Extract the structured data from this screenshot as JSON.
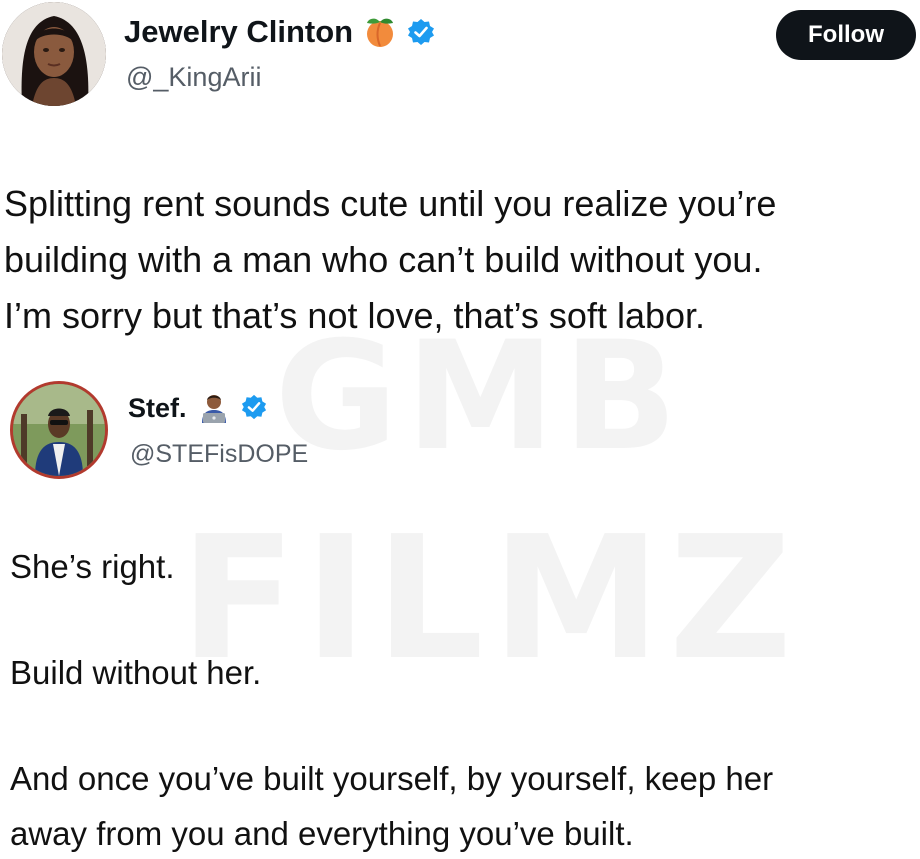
{
  "post": {
    "author": {
      "display_name": "Jewelry Clinton",
      "handle": "@_KingArii",
      "name_emoji": "peach-icon",
      "verified": true
    },
    "follow_label": "Follow",
    "text_lines": [
      "Splitting rent sounds cute until you realize you’re",
      "building with a man who can’t build without you.",
      "I’m sorry but that’s not love, that’s soft labor."
    ]
  },
  "reply": {
    "author": {
      "display_name": "Stef.",
      "handle": "@STEFisDOPE",
      "name_emoji": "technologist-icon",
      "verified": true
    },
    "text_lines": [
      "She’s right.",
      "Build without her.",
      "And once you’ve built yourself, by yourself, keep her",
      "away from you and everything you’ve built."
    ]
  },
  "watermark": {
    "line1": "GMB",
    "line2": "FILMZ"
  },
  "colors": {
    "verified_blue": "#1d9bf0",
    "follow_bg": "#0f1419",
    "handle_gray": "#555d66",
    "reply_avatar_ring": "#b23a2e",
    "peach": "#f28b3c"
  }
}
